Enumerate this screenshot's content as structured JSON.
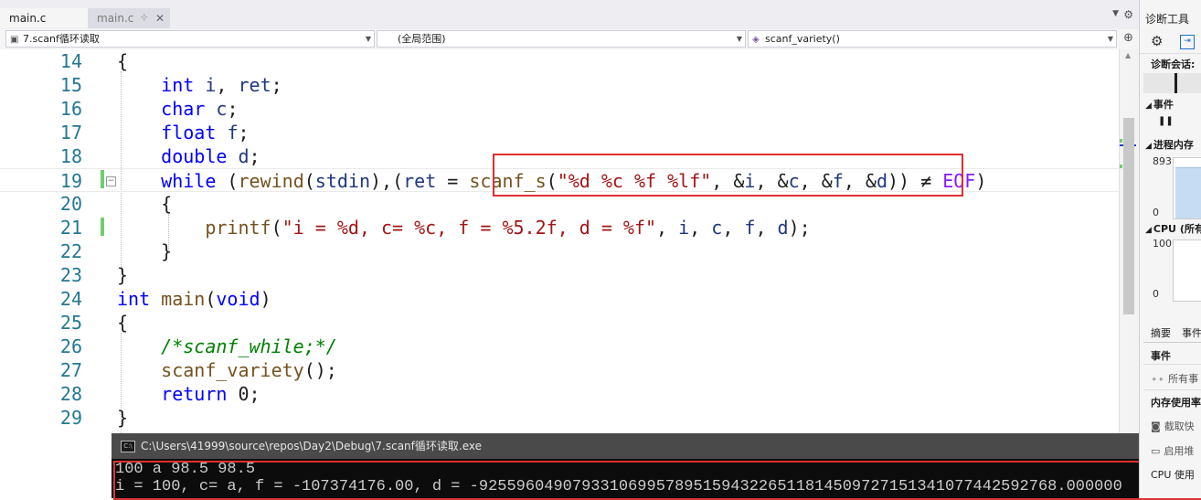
{
  "tabs": {
    "active_tab": "main.c",
    "preview_tab": "main.c",
    "pin_icon": "⊹",
    "close_icon": "✕"
  },
  "navbar": {
    "project": "7.scanf循环读取",
    "scope": "(全局范围)",
    "function": "scanf_variety()"
  },
  "editor": {
    "line_numbers": [
      "14",
      "15",
      "16",
      "17",
      "18",
      "19",
      "20",
      "21",
      "22",
      "23",
      "24",
      "25",
      "26",
      "27",
      "28",
      "29"
    ]
  },
  "console": {
    "title": "C:\\Users\\41999\\source\\repos\\Day2\\Debug\\7.scanf循环读取.exe",
    "icon_label": "C:\\",
    "lines": [
      "100 a 98.5 98.5",
      "i = 100, c= a, f = -107374176.00, d = -92559604907933106995789515943226511814509727151341077442592768.000000"
    ]
  },
  "diagnostics": {
    "title": "诊断工具",
    "session_label": "诊断会话:",
    "events_label": "事件",
    "memory_label": "进程内存",
    "memory_axis_top": "893",
    "memory_axis_bottom": "0",
    "cpu_label": "CPU (所有",
    "cpu_axis_top": "100",
    "cpu_axis_bottom": "0",
    "tab_summary": "摘要",
    "tab_events": "事件",
    "section_events": "事件",
    "all_events": "所有事",
    "section_memory": "内存使用率",
    "snapshot": "截取快",
    "enable": "启用堆",
    "cpu_usage": "CPU 使用"
  },
  "colors": {
    "keyword": "#0000ff",
    "function": "#74531f",
    "string": "#a31515",
    "comment": "#008000",
    "line_number": "#237893",
    "highlight_box": "#e03030",
    "console_bg": "#0c0c0c",
    "console_titlebar": "#4a4a4a"
  }
}
